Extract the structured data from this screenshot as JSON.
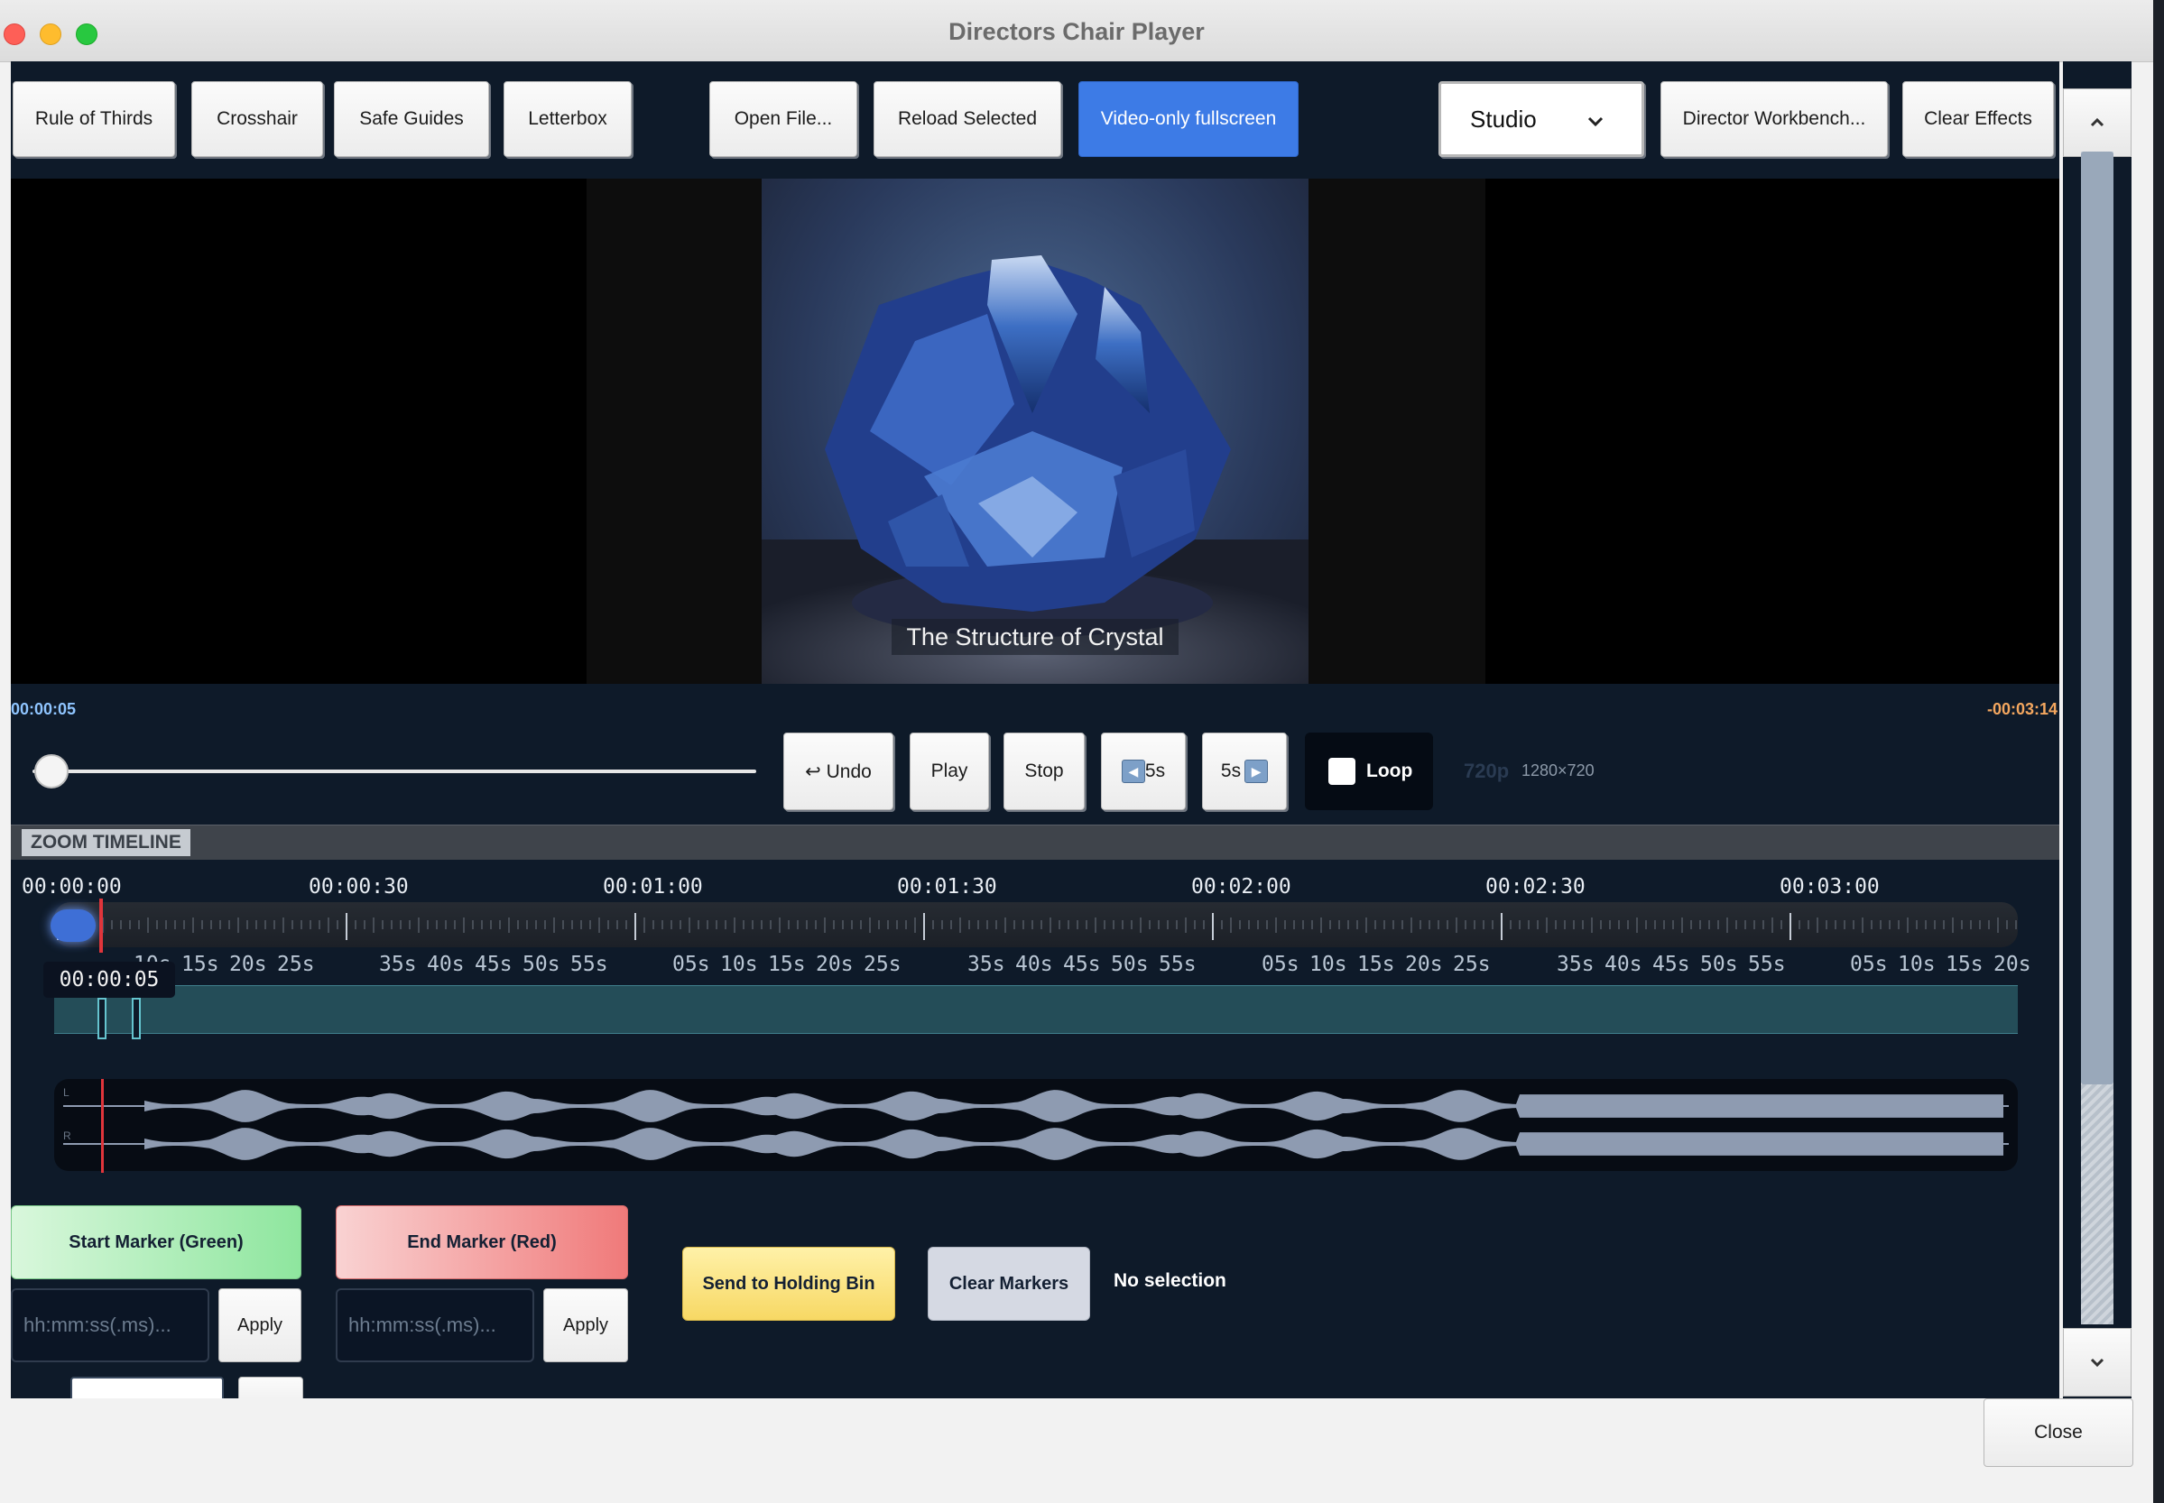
{
  "window": {
    "title": "Directors Chair Player"
  },
  "toolbar": {
    "buttons": [
      {
        "label": "Rule of Thirds"
      },
      {
        "label": "Crosshair"
      },
      {
        "label": "Safe Guides"
      },
      {
        "label": "Letterbox"
      },
      {
        "label": "Open File..."
      },
      {
        "label": "Reload Selected"
      },
      {
        "label": "Video-only fullscreen"
      },
      {
        "label": "Director Workbench..."
      },
      {
        "label": "Clear Effects"
      }
    ],
    "preset": {
      "value": "Studio"
    }
  },
  "video": {
    "caption": "The Structure of Crystal"
  },
  "playback": {
    "elapsed": "00:00:05",
    "remaining": "-00:03:14",
    "position_fraction": 0.026,
    "undo_label": "↩ Undo",
    "play_label": "Play",
    "stop_label": "Stop",
    "back_label": "5s",
    "forward_label": "5s",
    "loop_label": "Loop",
    "loop_checked": false,
    "quality": "720p",
    "resolution": "1280×720"
  },
  "zoom": {
    "header": "ZOOM TIMELINE",
    "major_labels": [
      "00:00:00",
      "00:00:30",
      "00:01:00",
      "00:01:30",
      "00:02:00",
      "00:02:30",
      "00:03:00"
    ],
    "second_labels": [
      "10s",
      "15s",
      "20s",
      "25s",
      "35s",
      "40s",
      "45s",
      "50s",
      "55s",
      "05s",
      "10s",
      "15s",
      "20s",
      "25s",
      "35s",
      "40s",
      "45s",
      "50s",
      "55s",
      "05s",
      "10s",
      "15s",
      "20s",
      "25s",
      "35s",
      "40s",
      "45s",
      "50s",
      "55s",
      "05s",
      "10s",
      "15s",
      "20s"
    ],
    "playhead_tooltip": "00:00:05",
    "waveform_channels": [
      "L",
      "R"
    ]
  },
  "markers": {
    "start_label": "Start Marker (Green)",
    "end_label": "End Marker (Red)",
    "start_placeholder": "hh:mm:ss(.ms)...",
    "end_placeholder": "hh:mm:ss(.ms)...",
    "apply_label": "Apply",
    "send_label": "Send to Holding Bin",
    "clear_label": "Clear Markers",
    "status": "No selection"
  },
  "scrollbar": {
    "up_icon": "chevron-up-icon",
    "down_icon": "chevron-down-icon"
  },
  "footer": {
    "close_label": "Close"
  },
  "colors": {
    "accent_blue": "#3d7be6",
    "panel_bg": "#0e1a29",
    "elapsed_color": "#8fc5ff",
    "remaining_color": "#f4a75f",
    "start_marker": "#8ee69e",
    "end_marker": "#f07a7a",
    "holding_bin": "#f7d864",
    "playhead": "#e0353b"
  }
}
